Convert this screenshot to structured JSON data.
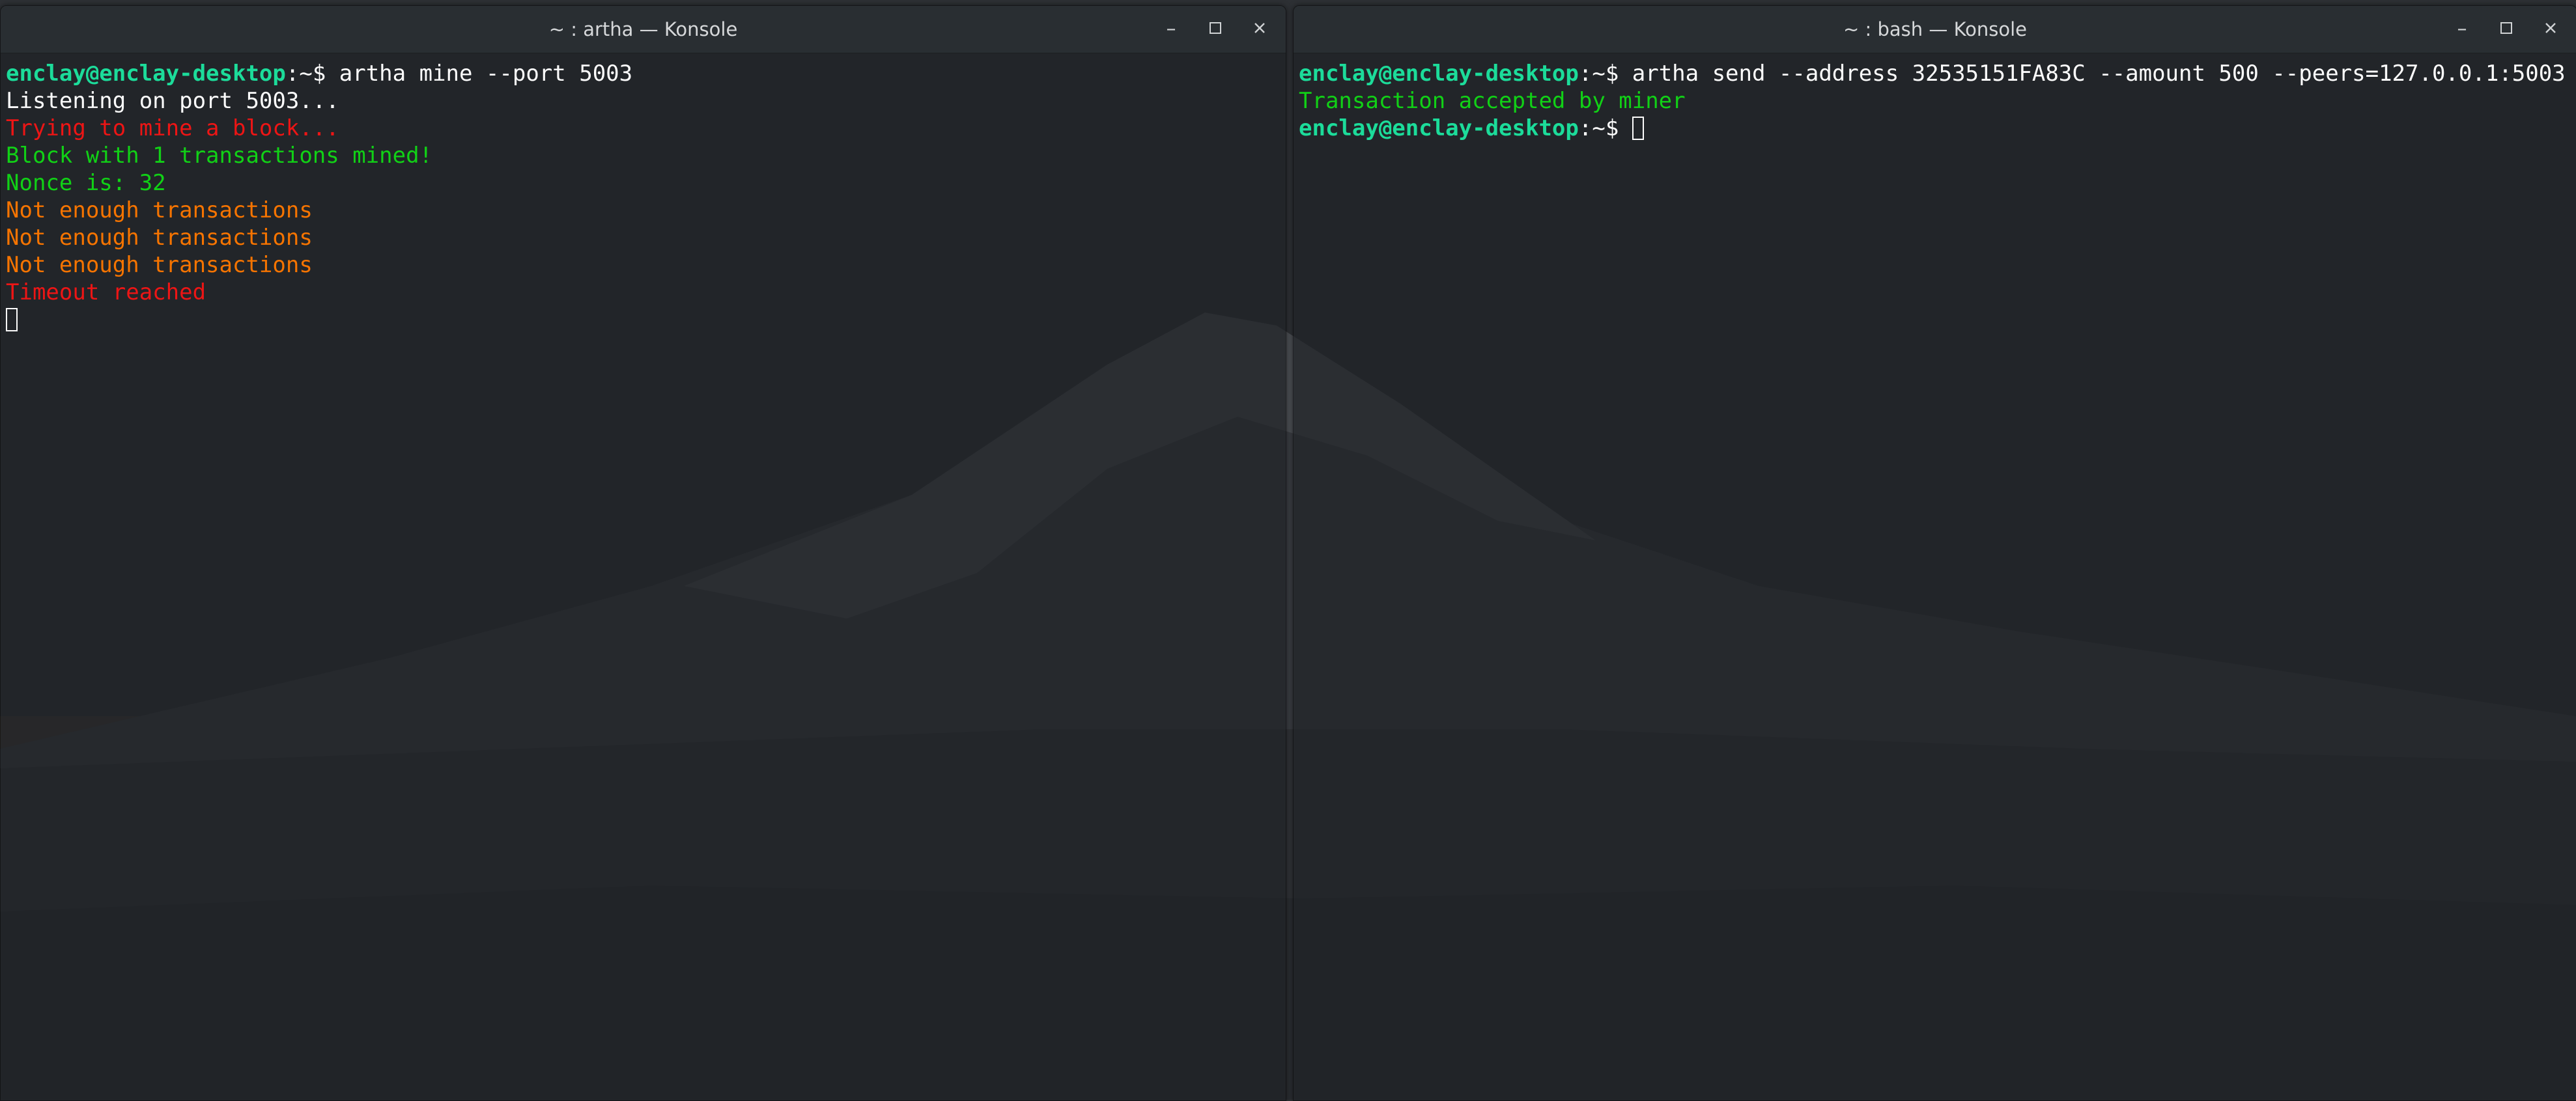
{
  "left_window": {
    "title": "~ : artha — Konsole",
    "controls": {
      "minimize": "–",
      "maximize": "□",
      "close": "×"
    },
    "terminal": {
      "prompt_user": "enclay@enclay-desktop",
      "prompt_sep": ":~$ ",
      "command": "artha mine --port 5003",
      "output": [
        {
          "text": "Listening on port 5003...",
          "color": "white"
        },
        {
          "text": "Trying to mine a block...",
          "color": "red"
        },
        {
          "text": "Block with 1 transactions mined!",
          "color": "green"
        },
        {
          "text": "Nonce is: 32",
          "color": "green"
        },
        {
          "text": "Not enough transactions",
          "color": "orange"
        },
        {
          "text": "Not enough transactions",
          "color": "orange"
        },
        {
          "text": "Not enough transactions",
          "color": "orange"
        },
        {
          "text": "Timeout reached",
          "color": "red"
        }
      ]
    }
  },
  "right_window": {
    "title": "~ : bash — Konsole",
    "controls": {
      "minimize": "–",
      "maximize": "□",
      "close": "×"
    },
    "terminal": {
      "prompt_user": "enclay@enclay-desktop",
      "prompt_sep": ":~$ ",
      "command": "artha send --address 32535151FA83C --amount 500 --peers=127.0.0.1:5003",
      "output": [
        {
          "text": "Transaction accepted by miner",
          "color": "green"
        }
      ],
      "second_prompt_user": "enclay@enclay-desktop",
      "second_prompt_sep": ":~$ "
    }
  },
  "colors": {
    "prompt_user": "#1cdc9a",
    "white": "#fcfcfc",
    "red": "#ed1515",
    "green": "#11d116",
    "orange": "#f67400"
  }
}
